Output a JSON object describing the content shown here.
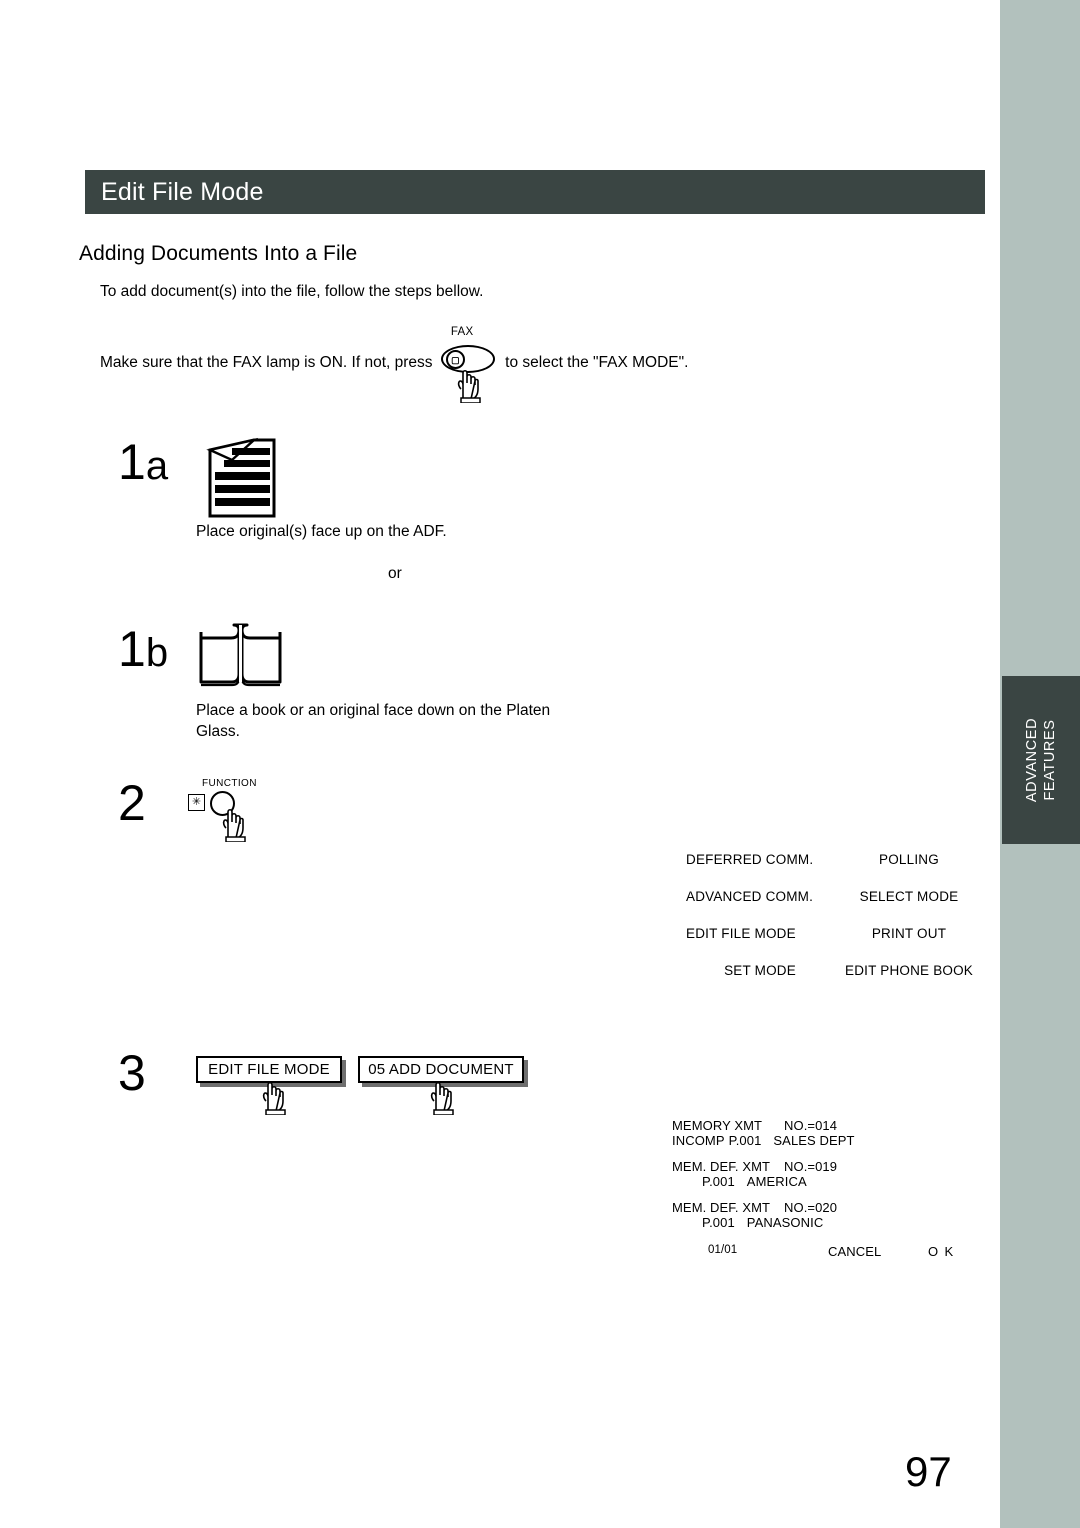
{
  "page": {
    "number": "97",
    "side_tab": "ADVANCED\nFEATURES",
    "side_tab_line1": "ADVANCED",
    "side_tab_line2": "FEATURES",
    "colors": {
      "banner": "#3a4543",
      "edge_strip": "#b2c1bd",
      "button_shadow": "#6e6e6e"
    }
  },
  "header": {
    "title": "Edit File Mode"
  },
  "section": {
    "title": "Adding Documents Into a File",
    "intro": "To add document(s) into the file, follow the steps bellow.",
    "fax_sentence_before": "Make sure that the FAX lamp is ON.  If not, press",
    "fax_sentence_after": "to select the \"FAX MODE\".",
    "fax_key_label": "FAX"
  },
  "steps": {
    "step1a": {
      "number": "1",
      "letter": "a",
      "caption": "Place original(s) face up on the ADF."
    },
    "or_text": "or",
    "step1b": {
      "number": "1",
      "letter": "b",
      "caption_line1": "Place a book or an original face down on the Platen",
      "caption_line2": "Glass."
    },
    "step2": {
      "number": "2",
      "key_label": "FUNCTION",
      "star_glyph": "✳"
    },
    "step3": {
      "number": "3",
      "button1": "EDIT FILE MODE",
      "button2": "05 ADD DOCUMENT"
    }
  },
  "lcd_menu": {
    "rows": [
      {
        "left": "DEFERRED COMM.",
        "right": "POLLING"
      },
      {
        "left": "ADVANCED COMM.",
        "right": "SELECT MODE"
      },
      {
        "left": "EDIT FILE MODE",
        "right": "PRINT OUT"
      },
      {
        "left": "SET MODE",
        "right": "EDIT PHONE BOOK"
      }
    ]
  },
  "lcd_list": {
    "entries": [
      {
        "type": "MEMORY XMT",
        "no": "NO.=014",
        "status": "INCOMP",
        "page": "P.001",
        "name": "SALES DEPT"
      },
      {
        "type": "MEM. DEF. XMT",
        "no": "NO.=019",
        "status": "",
        "page": "P.001",
        "name": "AMERICA"
      },
      {
        "type": "MEM. DEF. XMT",
        "no": "NO.=020",
        "status": "",
        "page": "P.001",
        "name": "PANASONIC"
      }
    ],
    "footer": {
      "page_indicator": "01/01",
      "cancel": "CANCEL",
      "ok": "O K"
    }
  }
}
